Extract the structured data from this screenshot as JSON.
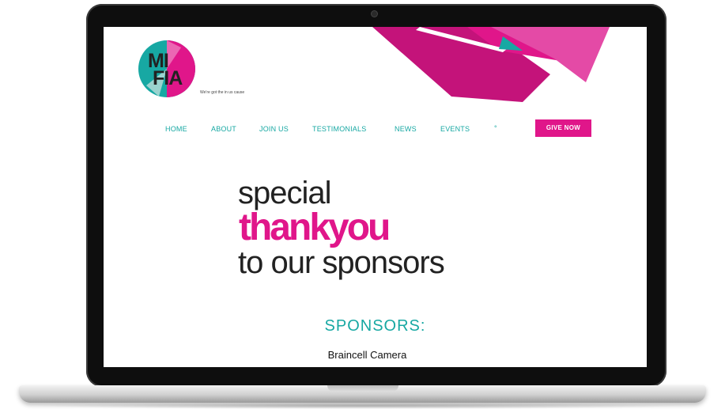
{
  "logo": {
    "line1": "MI",
    "line2": "FIA",
    "tagline": "We're got the in us cause"
  },
  "nav": {
    "items": [
      "HOME",
      "ABOUT",
      "JOIN US",
      "TESTIMONIALS",
      "NEWS",
      "EVENTS"
    ],
    "extra": "°",
    "cta": "GIVE NOW"
  },
  "hero": {
    "line1": "special",
    "line2": "thankyou",
    "line3": "to our sponsors"
  },
  "sponsors": {
    "heading": "SPONSORS:",
    "first": "Braincell Camera"
  },
  "colors": {
    "accent_pink": "#e0168a",
    "accent_teal": "#17a8a3",
    "text_dark": "#222222"
  }
}
